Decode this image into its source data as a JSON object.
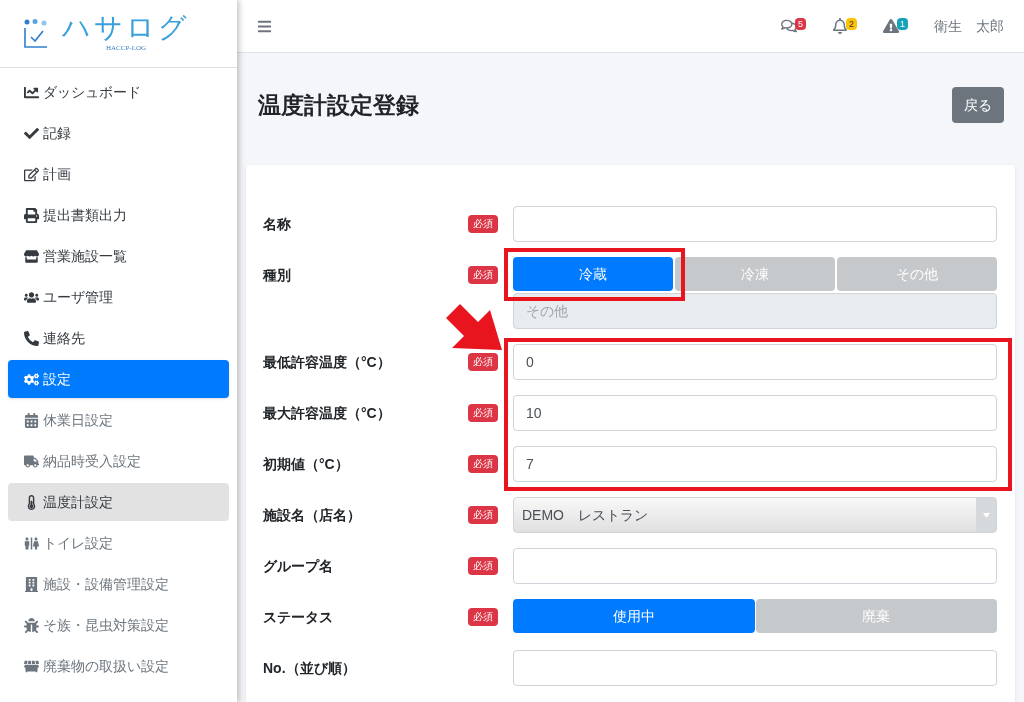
{
  "logo": {
    "name": "ハサログ",
    "sub": "HACCP-LOG"
  },
  "sidebar": {
    "items": [
      {
        "label": "ダッシュボード",
        "kind": "main",
        "selected": false
      },
      {
        "label": "記録",
        "kind": "main",
        "selected": false
      },
      {
        "label": "計画",
        "kind": "main",
        "selected": false
      },
      {
        "label": "提出書類出力",
        "kind": "main",
        "selected": false
      },
      {
        "label": "営業施設一覧",
        "kind": "main",
        "selected": false
      },
      {
        "label": "ユーザ管理",
        "kind": "main",
        "selected": false
      },
      {
        "label": "連絡先",
        "kind": "main",
        "selected": false
      },
      {
        "label": "設定",
        "kind": "main",
        "selected": true
      },
      {
        "label": "休業日設定",
        "kind": "sub",
        "selected": false
      },
      {
        "label": "納品時受入設定",
        "kind": "sub",
        "selected": false
      },
      {
        "label": "温度計設定",
        "kind": "sub",
        "selected": true
      },
      {
        "label": "トイレ設定",
        "kind": "sub",
        "selected": false
      },
      {
        "label": "施設・設備管理設定",
        "kind": "sub",
        "selected": false
      },
      {
        "label": "そ族・昆虫対策設定",
        "kind": "sub",
        "selected": false
      },
      {
        "label": "廃棄物の取扱い設定",
        "kind": "sub",
        "selected": false
      }
    ]
  },
  "header": {
    "badges": [
      {
        "count": "5",
        "color": "#dc3545"
      },
      {
        "count": "2",
        "color": "#ffc107"
      },
      {
        "count": "1",
        "color": "#17a2b8"
      }
    ],
    "user": "衛生　太郎"
  },
  "page": {
    "title": "温度計設定登録",
    "back_button": "戻る"
  },
  "form": {
    "rows": [
      {
        "label": "名称",
        "required": "必須",
        "kind": "text",
        "value": ""
      },
      {
        "label": "種別",
        "required": "必須",
        "kind": "toggle",
        "options": [
          {
            "label": "冷蔵",
            "selected": true
          },
          {
            "label": "冷凍",
            "selected": false
          },
          {
            "label": "その他",
            "selected": false
          }
        ],
        "extra": {
          "placeholder": "その他",
          "disabled": true
        }
      },
      {
        "label": "最低許容温度（°C）",
        "required": "必須",
        "kind": "text",
        "value": "0"
      },
      {
        "label": "最大許容温度（°C）",
        "required": "必須",
        "kind": "text",
        "value": "10"
      },
      {
        "label": "初期値（°C）",
        "required": "必須",
        "kind": "text",
        "value": "7"
      },
      {
        "label": "施設名（店名）",
        "required": "必須",
        "kind": "select",
        "value": "DEMO　レストラン"
      },
      {
        "label": "グループ名",
        "required": "必須",
        "kind": "text",
        "value": ""
      },
      {
        "label": "ステータス",
        "required": "必須",
        "kind": "toggle",
        "options": [
          {
            "label": "使用中",
            "selected": true
          },
          {
            "label": "廃棄",
            "selected": false
          }
        ]
      },
      {
        "label": "No.（並び順）",
        "kind": "text",
        "value": ""
      }
    ]
  }
}
